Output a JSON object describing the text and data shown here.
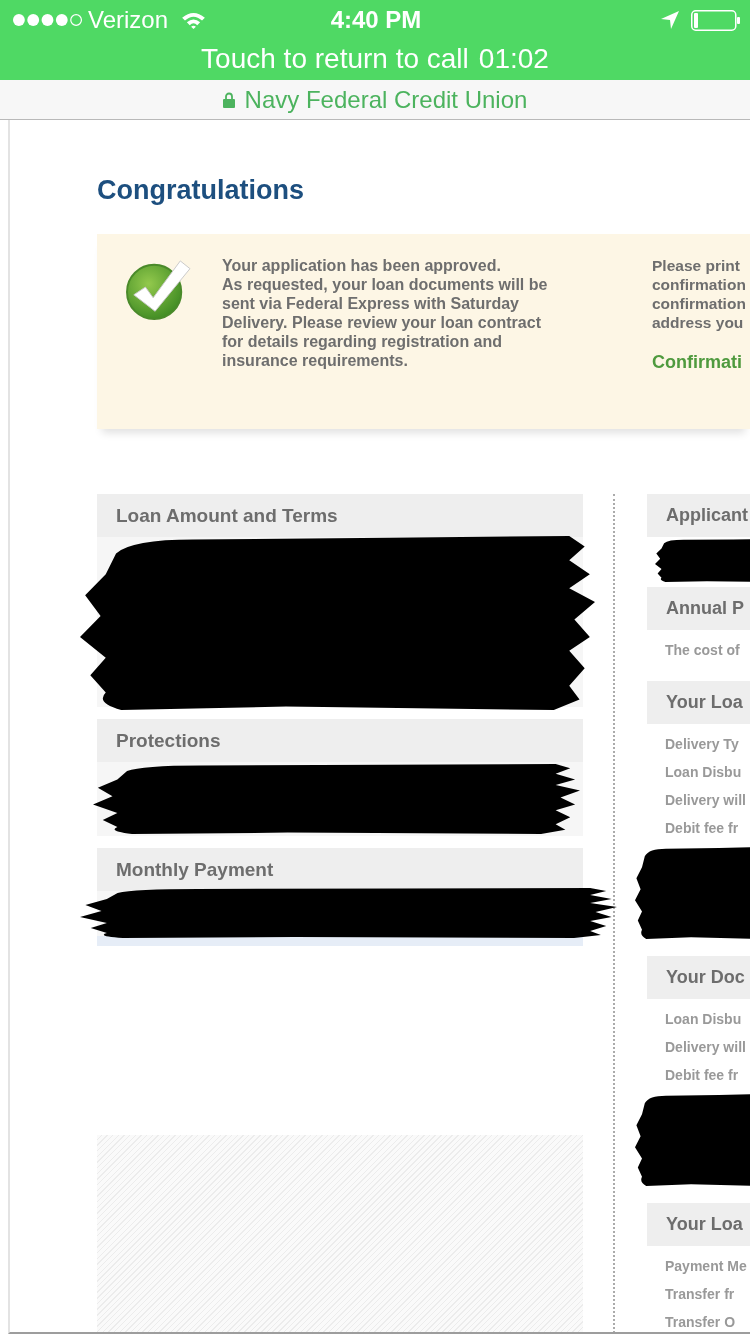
{
  "status_bar": {
    "carrier": "Verizon",
    "time": "4:40 PM"
  },
  "call_banner": {
    "label": "Touch to return to call",
    "timer": "01:02"
  },
  "address_bar": {
    "title": "Navy Federal Credit Union",
    "secure": true
  },
  "page": {
    "heading": "Congratulations",
    "approval_notice": {
      "message": [
        "Your application has been approved.",
        "As requested, your loan documents will be sent via Federal Express with Saturday Delivery. Please review your loan contract for details regarding registration and insurance requirements."
      ],
      "instructions": [
        "Please print",
        "confirmation",
        "confirmation",
        "address you"
      ],
      "confirmation_label": "Confirmati"
    },
    "left_sections": [
      {
        "title": "Loan Amount and Terms",
        "redacted": true
      },
      {
        "title": "Protections",
        "redacted": true
      },
      {
        "title": "Monthly Payment",
        "redacted": true
      }
    ],
    "right_sections": [
      {
        "title": "Applicant",
        "redacted": true
      },
      {
        "title": "Annual P",
        "lines": [
          "The cost of"
        ],
        "redacted": false
      },
      {
        "title": "Your Loa",
        "lines": [
          "Delivery Ty",
          "Loan Disbu",
          "Delivery will",
          "Debit fee fr"
        ],
        "redacted": true
      },
      {
        "title": "Your Doc",
        "lines": [
          "Loan Disbu",
          "Delivery will",
          "Debit fee fr"
        ],
        "redacted": true
      },
      {
        "title": "Your Loa",
        "lines": [
          "Payment Me",
          "Transfer fr",
          "Transfer O"
        ],
        "redacted": false
      }
    ]
  }
}
